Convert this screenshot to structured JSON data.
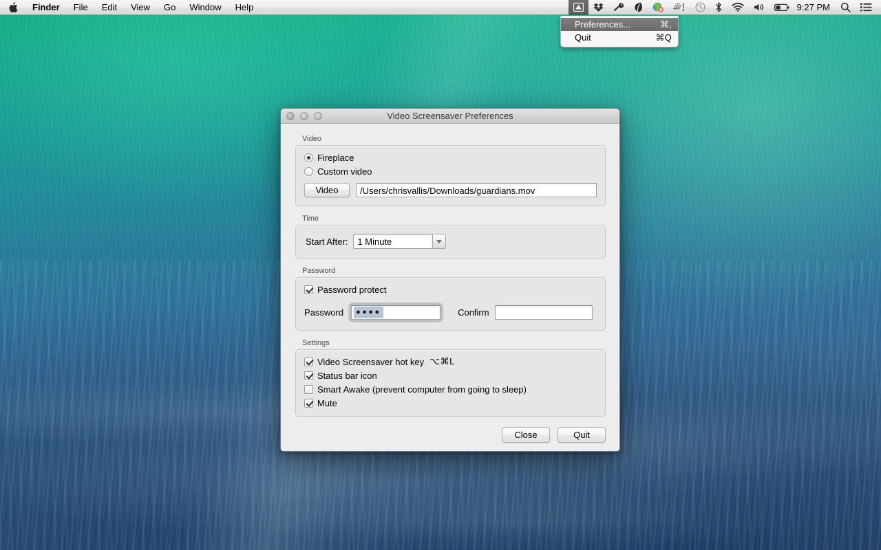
{
  "menubar": {
    "apple_icon": "apple-logo-icon",
    "items": [
      {
        "label": "Finder",
        "bold": true
      },
      {
        "label": "File",
        "bold": false
      },
      {
        "label": "Edit",
        "bold": false
      },
      {
        "label": "View",
        "bold": false
      },
      {
        "label": "Go",
        "bold": false
      },
      {
        "label": "Window",
        "bold": false
      },
      {
        "label": "Help",
        "bold": false
      }
    ],
    "status_icons": [
      {
        "name": "video-screensaver-status-icon",
        "active": true
      },
      {
        "name": "dropbox-icon",
        "active": false
      },
      {
        "name": "flashlight-key-icon",
        "active": false
      },
      {
        "name": "leaf-icon",
        "active": false
      },
      {
        "name": "globe-error-icon",
        "active": false
      },
      {
        "name": "dotted-alert-icon",
        "active": false
      },
      {
        "name": "time-machine-icon",
        "active": false
      },
      {
        "name": "bluetooth-icon",
        "active": false
      },
      {
        "name": "wifi-icon",
        "active": false
      },
      {
        "name": "volume-icon",
        "active": false
      },
      {
        "name": "battery-icon",
        "active": false
      }
    ],
    "clock": "9:27 PM",
    "spotlight_icon": "search-icon",
    "notification_center_icon": "notification-center-icon"
  },
  "status_menu": {
    "items": [
      {
        "label": "Preferences...",
        "shortcut": "⌘,",
        "selected": true
      },
      {
        "label": "Quit",
        "shortcut": "⌘Q",
        "selected": false
      }
    ]
  },
  "dialog": {
    "title": "Video Screensaver Preferences",
    "video": {
      "group_title": "Video",
      "radio_fireplace": {
        "label": "Fireplace",
        "selected": true
      },
      "radio_custom": {
        "label": "Custom video",
        "selected": false
      },
      "video_button": "Video",
      "path_value": "/Users/chrisvallis/Downloads/guardians.mov",
      "path_placeholder": ""
    },
    "time": {
      "group_title": "Time",
      "start_after_label": "Start After:",
      "start_after_value": "1 Minute",
      "dropdown_icon": "chevron-down-icon"
    },
    "password": {
      "group_title": "Password",
      "protect_checkbox": {
        "label": "Password protect",
        "checked": true
      },
      "password_label": "Password",
      "password_value": "●●●●",
      "confirm_label": "Confirm",
      "confirm_value": "",
      "confirm_placeholder": ""
    },
    "settings": {
      "group_title": "Settings",
      "items": [
        {
          "label": "Video Screensaver hot key",
          "hotkey": "⌥⌘L",
          "checked": true
        },
        {
          "label": "Status bar icon",
          "hotkey": "",
          "checked": true
        },
        {
          "label": "Smart Awake (prevent computer from going to sleep)",
          "hotkey": "",
          "checked": false
        },
        {
          "label": "Mute",
          "hotkey": "",
          "checked": true
        }
      ]
    },
    "footer": {
      "close_label": "Close",
      "quit_label": "Quit"
    }
  },
  "colors": {
    "wallpaper_top": "#13ab85",
    "wallpaper_bottom": "#264467",
    "dialog_bg": "#ededed",
    "group_bg": "#e6e6e6",
    "menu_highlight": "#6a6a6a",
    "selection_blue": "#b9c4d6"
  }
}
